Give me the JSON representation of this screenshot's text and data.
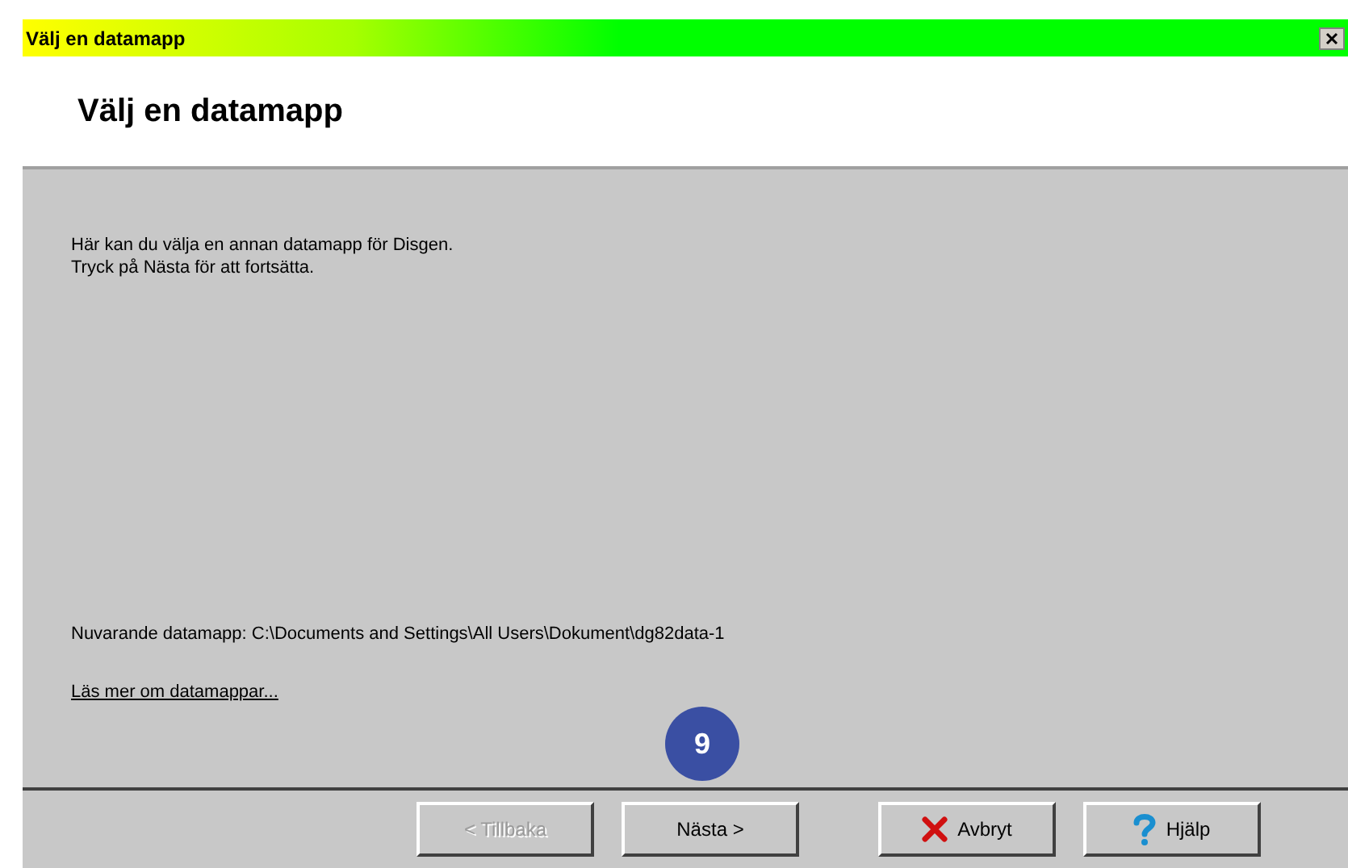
{
  "window": {
    "title": "Välj en datamapp"
  },
  "header": {
    "title": "Välj en datamapp"
  },
  "body": {
    "intro": [
      "Här kan du välja en annan datamapp för Disgen.",
      "Tryck på Nästa för att fortsätta."
    ],
    "current_folder": "Nuvarande datamapp: C:\\Documents and Settings\\All Users\\Dokument\\dg82data-1",
    "link": "Läs mer om datamappar..."
  },
  "step_badge": "9",
  "buttons": [
    {
      "kind": "back",
      "label": "< Tillbaka",
      "disabled": true
    },
    {
      "kind": "next",
      "label": "Nästa >",
      "disabled": false
    },
    {
      "kind": "cancel",
      "label": "Avbryt",
      "disabled": false
    },
    {
      "kind": "help",
      "label": "Hjälp",
      "disabled": false
    }
  ]
}
